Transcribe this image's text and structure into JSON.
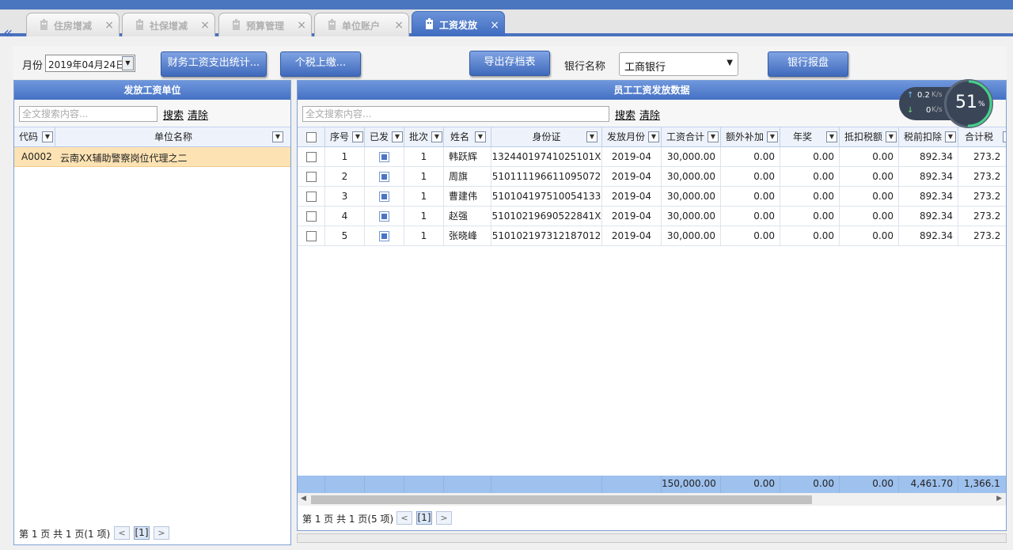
{
  "tabs": [
    {
      "label": "住房增减",
      "icon": "building-icon",
      "active": false
    },
    {
      "label": "社保增减",
      "icon": "building-icon",
      "active": false
    },
    {
      "label": "预算管理",
      "icon": "building-icon",
      "active": false
    },
    {
      "label": "单位账户",
      "icon": "building-icon",
      "active": false
    },
    {
      "label": "工资发放",
      "icon": "building-icon",
      "active": true
    }
  ],
  "tab_close_glyph": "×",
  "collapse_glyph": "«",
  "toolbar": {
    "month_label": "月份",
    "month_value": "2019年04月24日",
    "btn_stats": "财务工资支出统计...",
    "btn_tax": "个税上缴...",
    "btn_export": "导出存档表",
    "bank_label": "银行名称",
    "bank_value": "工商银行",
    "btn_bank": "银行报盘"
  },
  "left_panel": {
    "title": "发放工资单位",
    "search_placeholder": "全文搜索内容...",
    "search_link": "搜索",
    "clear_link": "清除",
    "columns": [
      "代码",
      "单位名称"
    ],
    "rows": [
      {
        "code": "A0002",
        "name": "云南XX辅助警察岗位代理之二"
      }
    ],
    "pager": {
      "text": "第 1 页 共 1 页(1 项)",
      "current": "[1]",
      "prev": "<",
      "next": ">"
    }
  },
  "right_panel": {
    "title": "员工工资发放数据",
    "search_placeholder": "全文搜索内容...",
    "search_link": "搜索",
    "clear_link": "清除",
    "columns": [
      "序号",
      "已发",
      "批次",
      "姓名",
      "身份证",
      "发放月份",
      "工资合计",
      "额外补加",
      "年奖",
      "抵扣税额",
      "税前扣除",
      "合计税"
    ],
    "rows": [
      {
        "no": "1",
        "batch": "1",
        "name": "韩跃辉",
        "id": "13244019741025101X",
        "month": "2019-04",
        "total": "30,000.00",
        "extra": "0.00",
        "bonus": "0.00",
        "deduct": "0.00",
        "pretax": "892.34",
        "tax": "273.2"
      },
      {
        "no": "2",
        "batch": "1",
        "name": "周旗",
        "id": "510111196611095072",
        "month": "2019-04",
        "total": "30,000.00",
        "extra": "0.00",
        "bonus": "0.00",
        "deduct": "0.00",
        "pretax": "892.34",
        "tax": "273.2"
      },
      {
        "no": "3",
        "batch": "1",
        "name": "曹建伟",
        "id": "510104197510054133",
        "month": "2019-04",
        "total": "30,000.00",
        "extra": "0.00",
        "bonus": "0.00",
        "deduct": "0.00",
        "pretax": "892.34",
        "tax": "273.2"
      },
      {
        "no": "4",
        "batch": "1",
        "name": "赵强",
        "id": "51010219690522841X",
        "month": "2019-04",
        "total": "30,000.00",
        "extra": "0.00",
        "bonus": "0.00",
        "deduct": "0.00",
        "pretax": "892.34",
        "tax": "273.2"
      },
      {
        "no": "5",
        "batch": "1",
        "name": "张晓峰",
        "id": "510102197312187012",
        "month": "2019-04",
        "total": "30,000.00",
        "extra": "0.00",
        "bonus": "0.00",
        "deduct": "0.00",
        "pretax": "892.34",
        "tax": "273.2"
      }
    ],
    "footer": {
      "total": "150,000.00",
      "extra": "0.00",
      "bonus": "0.00",
      "deduct": "0.00",
      "pretax": "4,461.70",
      "tax": "1,366.1"
    },
    "pager": {
      "text": "第 1 页 共 1 页(5 项)",
      "current": "[1]",
      "prev": "<",
      "next": ">"
    }
  },
  "net_widget": {
    "up": "0.2",
    "up_unit": "K/s",
    "down": "0",
    "down_unit": "K/s",
    "percent": "51",
    "percent_sign": "%"
  },
  "colors": {
    "accent": "#4a75bf",
    "header_blue": "#4571c3",
    "selected_row": "#fde3b3"
  }
}
